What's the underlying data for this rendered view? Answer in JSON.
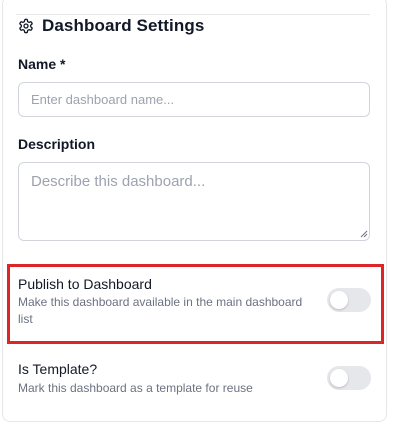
{
  "header": {
    "title": "Dashboard Settings",
    "icon": "gear-icon"
  },
  "name_field": {
    "label": "Name *",
    "placeholder": "Enter dashboard name...",
    "value": ""
  },
  "description_field": {
    "label": "Description",
    "placeholder": "Describe this dashboard...",
    "value": ""
  },
  "publish": {
    "label": "Publish to Dashboard",
    "description": "Make this dashboard available in the main dashboard list",
    "enabled": false,
    "highlight_color": "#dc2626"
  },
  "template": {
    "label": "Is Template?",
    "description": "Mark this dashboard as a template for reuse",
    "enabled": false
  },
  "colors": {
    "text": "#111827",
    "muted": "#6b7280",
    "toggle_off": "#e5e7eb",
    "border": "#d1d5db"
  }
}
